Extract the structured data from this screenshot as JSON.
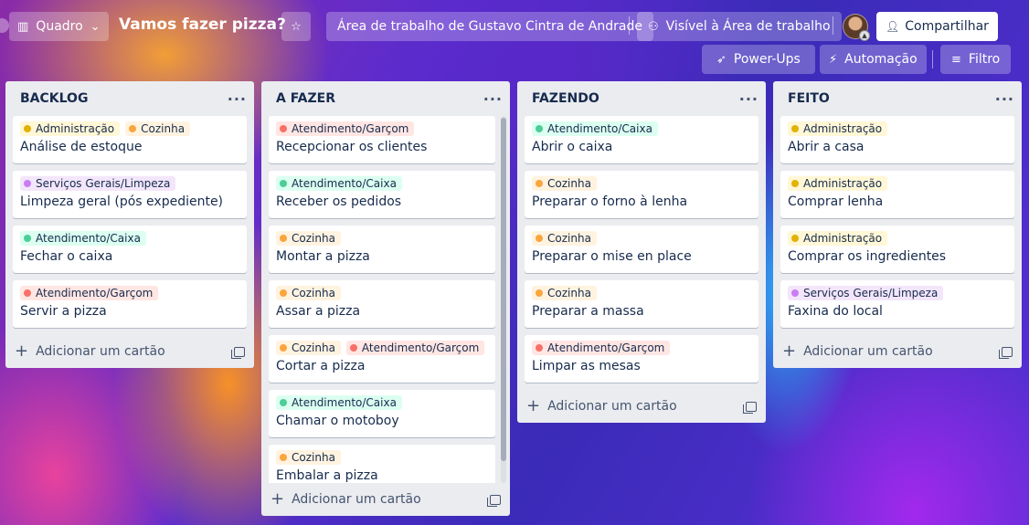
{
  "header": {
    "view_switcher_label": "Quadro",
    "board_title": "Vamos fazer pizza?",
    "workspace_label": "Área de trabalho de Gustavo Cintra de Andrade",
    "visibility_label": "Visível à Área de trabalho",
    "share_label": "Compartilhar",
    "powerups_label": "Power-Ups",
    "automation_label": "Automação",
    "filter_label": "Filtro"
  },
  "label_colors": {
    "Administração": {
      "bg": "#fff7d6",
      "dot": "#e2b203"
    },
    "Cozinha": {
      "bg": "#fff3e0",
      "dot": "#faa53d"
    },
    "Serviços Gerais/Limpeza": {
      "bg": "#f3e6fb",
      "dot": "#c97cf4"
    },
    "Atendimento/Caixa": {
      "bg": "#dcfff1",
      "dot": "#4bce97"
    },
    "Atendimento/Garçom": {
      "bg": "#ffe6e3",
      "dot": "#f87168"
    }
  },
  "add_card_label": "Adicionar um cartão",
  "lists": [
    {
      "title": "BACKLOG",
      "cards": [
        {
          "labels": [
            "Administração",
            "Cozinha"
          ],
          "title": "Análise de estoque"
        },
        {
          "labels": [
            "Serviços Gerais/Limpeza"
          ],
          "title": "Limpeza geral (pós expediente)"
        },
        {
          "labels": [
            "Atendimento/Caixa"
          ],
          "title": "Fechar o caixa"
        },
        {
          "labels": [
            "Atendimento/Garçom"
          ],
          "title": "Servir a pizza"
        }
      ]
    },
    {
      "title": "A FAZER",
      "cards": [
        {
          "labels": [
            "Atendimento/Garçom"
          ],
          "title": "Recepcionar os clientes"
        },
        {
          "labels": [
            "Atendimento/Caixa"
          ],
          "title": "Receber os pedidos"
        },
        {
          "labels": [
            "Cozinha"
          ],
          "title": "Montar a pizza"
        },
        {
          "labels": [
            "Cozinha"
          ],
          "title": "Assar a pizza"
        },
        {
          "labels": [
            "Cozinha",
            "Atendimento/Garçom"
          ],
          "title": "Cortar a pizza"
        },
        {
          "labels": [
            "Atendimento/Caixa"
          ],
          "title": "Chamar o motoboy"
        },
        {
          "labels": [
            "Cozinha"
          ],
          "title": "Embalar a pizza"
        }
      ]
    },
    {
      "title": "FAZENDO",
      "cards": [
        {
          "labels": [
            "Atendimento/Caixa"
          ],
          "title": "Abrir o caixa"
        },
        {
          "labels": [
            "Cozinha"
          ],
          "title": "Preparar o forno à lenha"
        },
        {
          "labels": [
            "Cozinha"
          ],
          "title": "Preparar o mise en place"
        },
        {
          "labels": [
            "Cozinha"
          ],
          "title": "Preparar a massa"
        },
        {
          "labels": [
            "Atendimento/Garçom"
          ],
          "title": "Limpar as mesas"
        }
      ]
    },
    {
      "title": "FEITO",
      "cards": [
        {
          "labels": [
            "Administração"
          ],
          "title": "Abrir a casa"
        },
        {
          "labels": [
            "Administração"
          ],
          "title": "Comprar lenha"
        },
        {
          "labels": [
            "Administração"
          ],
          "title": "Comprar os ingredientes"
        },
        {
          "labels": [
            "Serviços Gerais/Limpeza"
          ],
          "title": "Faxina do local"
        }
      ]
    }
  ]
}
